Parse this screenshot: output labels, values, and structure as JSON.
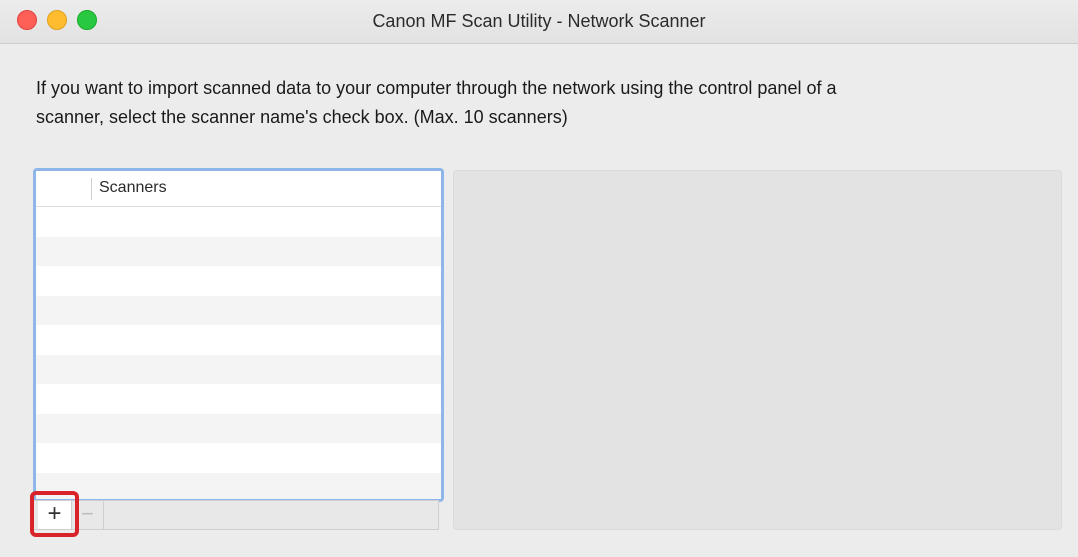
{
  "window": {
    "title": "Canon MF Scan Utility - Network Scanner"
  },
  "instructions": {
    "line1": "If you want to import scanned data to your computer through the network using the control panel of a",
    "line2": "scanner, select the scanner name's check box. (Max. 10 scanners)"
  },
  "scanner_list": {
    "column_header": "Scanners",
    "rows": []
  },
  "toolbar": {
    "add_label": "+",
    "remove_label": "−"
  },
  "colors": {
    "focus_ring": "#8fb6ea",
    "highlight": "#d9232a",
    "close": "#fe5f57",
    "minimize": "#febc2e",
    "zoom": "#28c840"
  }
}
